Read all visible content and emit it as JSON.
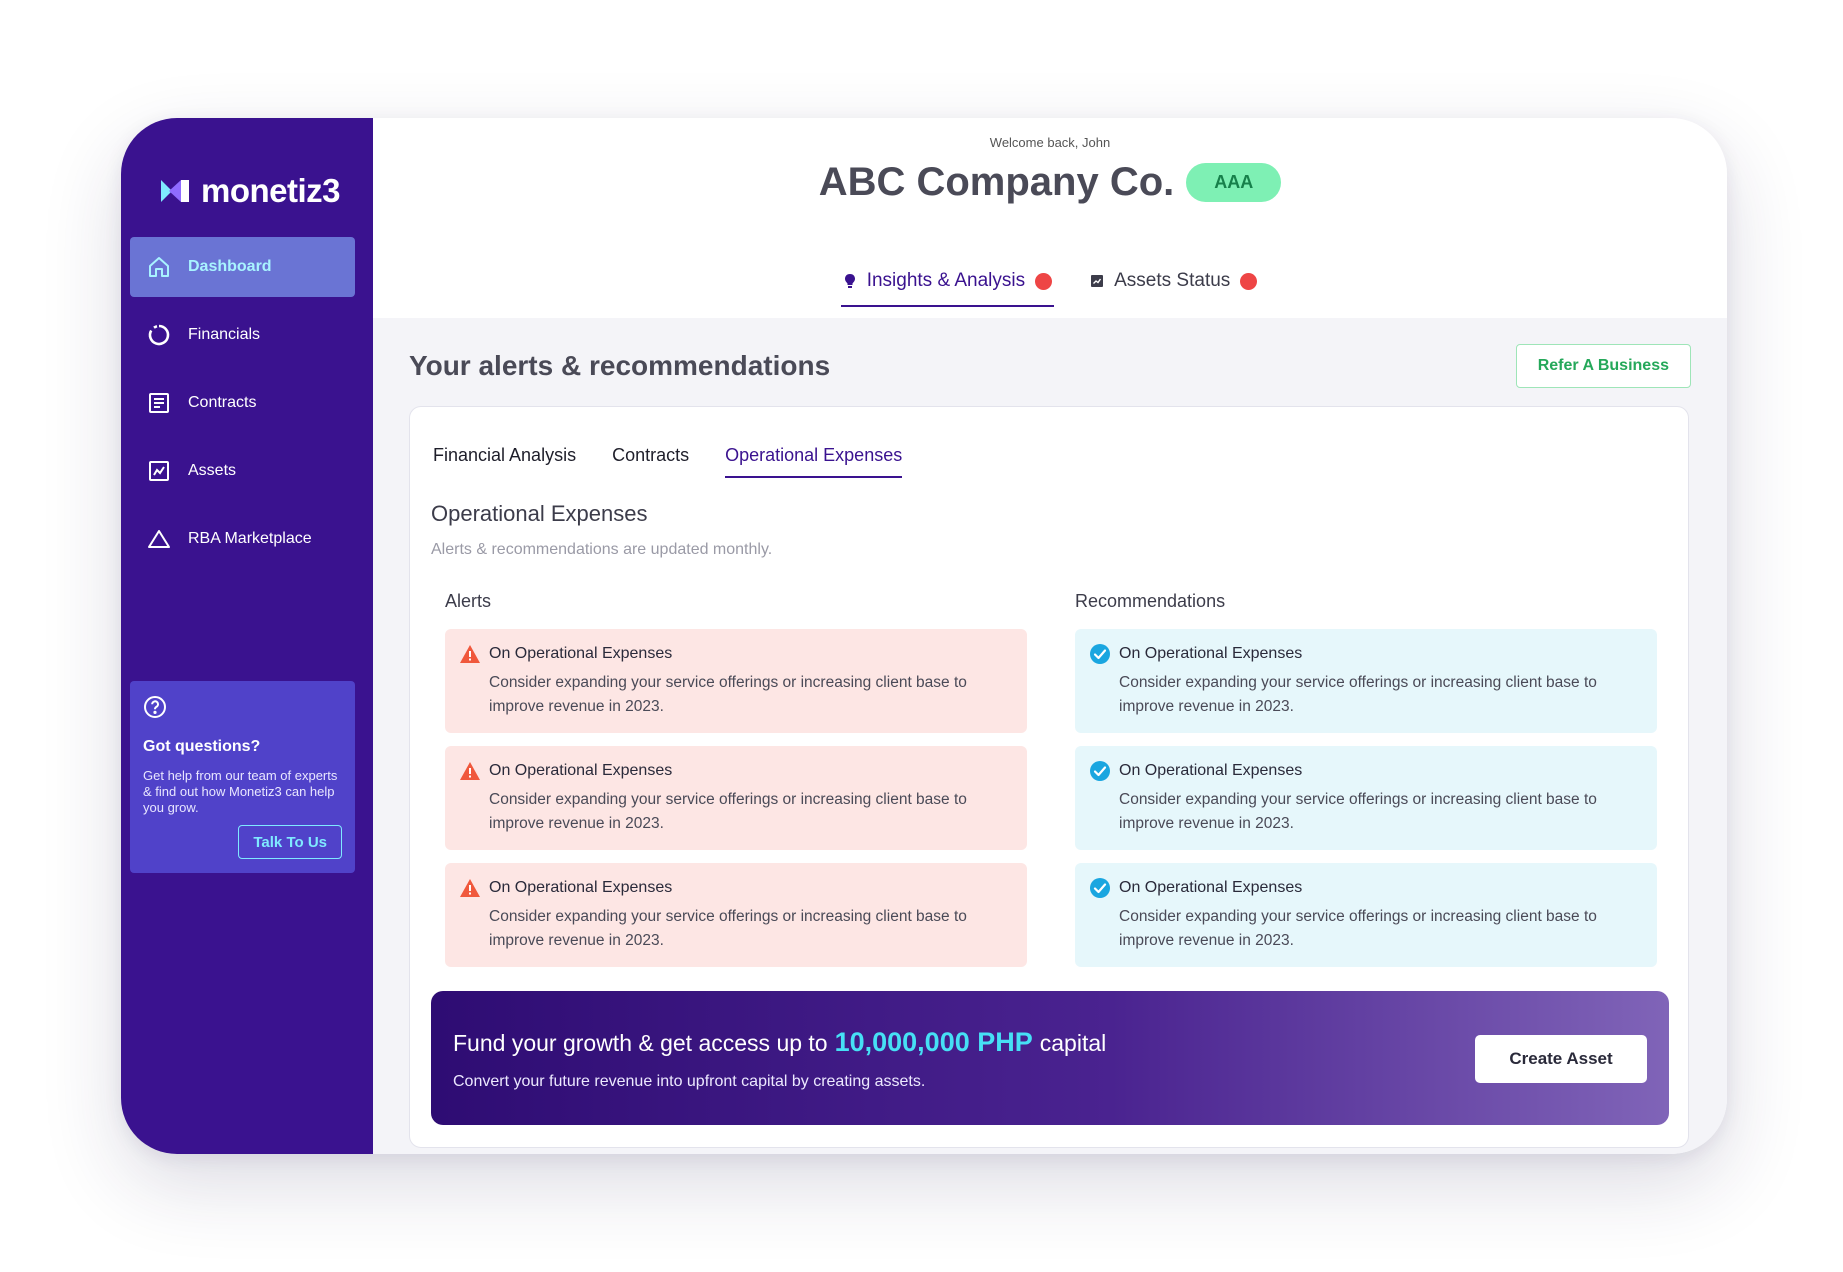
{
  "brand": {
    "name": "monetiz3"
  },
  "sidebar": {
    "items": [
      {
        "label": "Dashboard",
        "icon": "home-icon",
        "active": true
      },
      {
        "label": "Financials",
        "icon": "donut-chart-icon",
        "active": false
      },
      {
        "label": "Contracts",
        "icon": "document-icon",
        "active": false
      },
      {
        "label": "Assets",
        "icon": "trend-chart-icon",
        "active": false
      },
      {
        "label": "RBA Marketplace",
        "icon": "triangle-icon",
        "active": false
      }
    ],
    "help": {
      "title": "Got questions?",
      "text": "Get help from our team of experts & find out how Monetiz3 can help you grow.",
      "button": "Talk To Us"
    }
  },
  "header": {
    "welcome": "Welcome back, John",
    "company": "ABC Company Co.",
    "rating": "AAA",
    "tabs": [
      {
        "label": "Insights & Analysis",
        "icon": "bulb-icon",
        "active": true
      },
      {
        "label": "Assets Status",
        "icon": "status-chart-icon",
        "active": false
      }
    ]
  },
  "main": {
    "title": "Your alerts & recommendations",
    "refer_button": "Refer A Business",
    "subtabs": [
      {
        "label": "Financial Analysis",
        "active": false
      },
      {
        "label": "Contracts",
        "active": false
      },
      {
        "label": "Operational Expenses",
        "active": true
      }
    ],
    "panel_title": "Operational Expenses",
    "panel_subtitle": "Alerts & recommendations are updated monthly.",
    "alerts": {
      "title": "Alerts",
      "items": [
        {
          "title": "On Operational Expenses",
          "body": "Consider expanding your service offerings or increasing client base to improve revenue in 2023."
        },
        {
          "title": "On Operational Expenses",
          "body": "Consider expanding your service offerings or increasing client base to improve revenue in 2023."
        },
        {
          "title": "On Operational Expenses",
          "body": "Consider expanding your service offerings or increasing client base to improve revenue in 2023."
        }
      ]
    },
    "recommendations": {
      "title": "Recommendations",
      "items": [
        {
          "title": "On Operational Expenses",
          "body": "Consider expanding your service offerings or increasing client base to improve revenue in 2023."
        },
        {
          "title": "On Operational Expenses",
          "body": "Consider expanding your service offerings or increasing client base to improve revenue in 2023."
        },
        {
          "title": "On Operational Expenses",
          "body": "Consider expanding your service offerings or increasing client base to improve revenue in 2023."
        }
      ]
    },
    "promo": {
      "prefix": "Fund your growth & get access up to",
      "amount": "10,000,000 PHP",
      "suffix": "capital",
      "subtitle": "Convert your future revenue into upfront capital by creating assets.",
      "button": "Create Asset"
    }
  },
  "colors": {
    "sidebar": "#3a128f",
    "accent": "#3a128f",
    "active_nav": "#6a74d4",
    "rating_badge": "#7ef0b4",
    "alert_bg": "#fde6e4",
    "recommendation_bg": "#e6f7fb",
    "highlight": "#46e0f5",
    "notification_dot": "#ee4545"
  }
}
